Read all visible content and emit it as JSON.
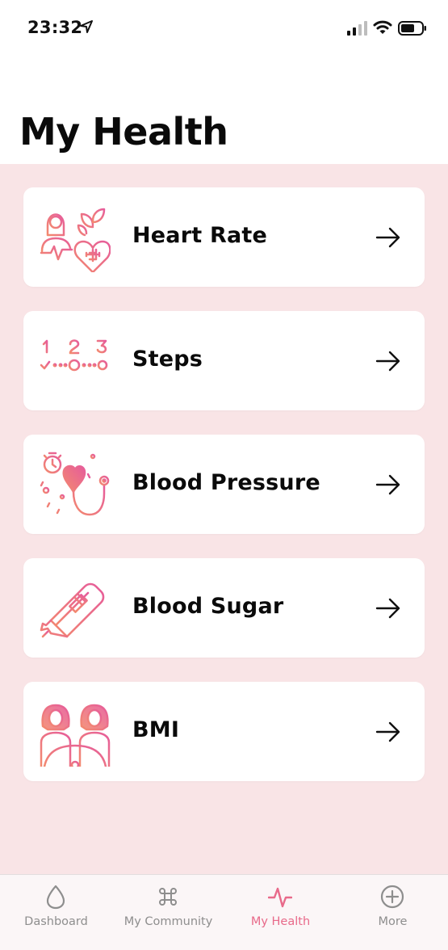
{
  "status_bar": {
    "time": "23:32"
  },
  "page": {
    "title": "My Health"
  },
  "colors": {
    "accent": "#e86a8a",
    "background": "#f9e4e6",
    "gradient_start": "#f38a6f",
    "gradient_end": "#e65c9b"
  },
  "cards": [
    {
      "label": "Heart Rate",
      "icon": "heart-rate-icon"
    },
    {
      "label": "Steps",
      "icon": "steps-icon"
    },
    {
      "label": "Blood Pressure",
      "icon": "blood-pressure-icon"
    },
    {
      "label": "Blood Sugar",
      "icon": "blood-sugar-icon"
    },
    {
      "label": "BMI",
      "icon": "bmi-icon"
    }
  ],
  "tab_bar": {
    "items": [
      {
        "label": "Dashboard",
        "icon": "drop-icon"
      },
      {
        "label": "My Community",
        "icon": "command-icon"
      },
      {
        "label": "My Health",
        "icon": "pulse-icon",
        "active": true
      },
      {
        "label": "More",
        "icon": "plus-circle-icon"
      }
    ]
  }
}
